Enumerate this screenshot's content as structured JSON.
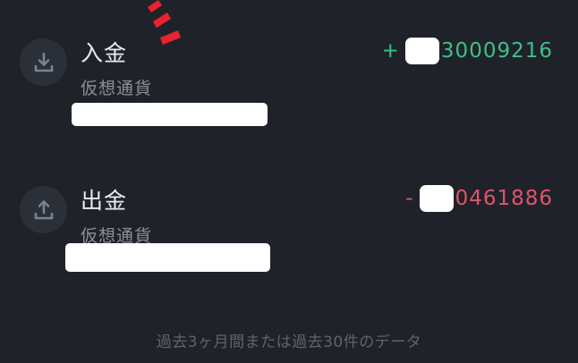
{
  "transactions": [
    {
      "type_label": "入金",
      "asset_label": "仮想通貨",
      "amount_sign": "+",
      "amount_visible": "30009216",
      "icon": "download-icon"
    },
    {
      "type_label": "出金",
      "asset_label": "仮想通貨",
      "amount_sign": "-",
      "amount_visible": "0461886",
      "icon": "upload-icon"
    }
  ],
  "footer": {
    "note": "過去3ヶ月間または過去30件のデータ"
  },
  "colors": {
    "background": "#1f2329",
    "positive": "#3cbf8a",
    "negative": "#e0546b",
    "icon_bg": "#2b3038",
    "annotation_red": "#e8232f"
  }
}
